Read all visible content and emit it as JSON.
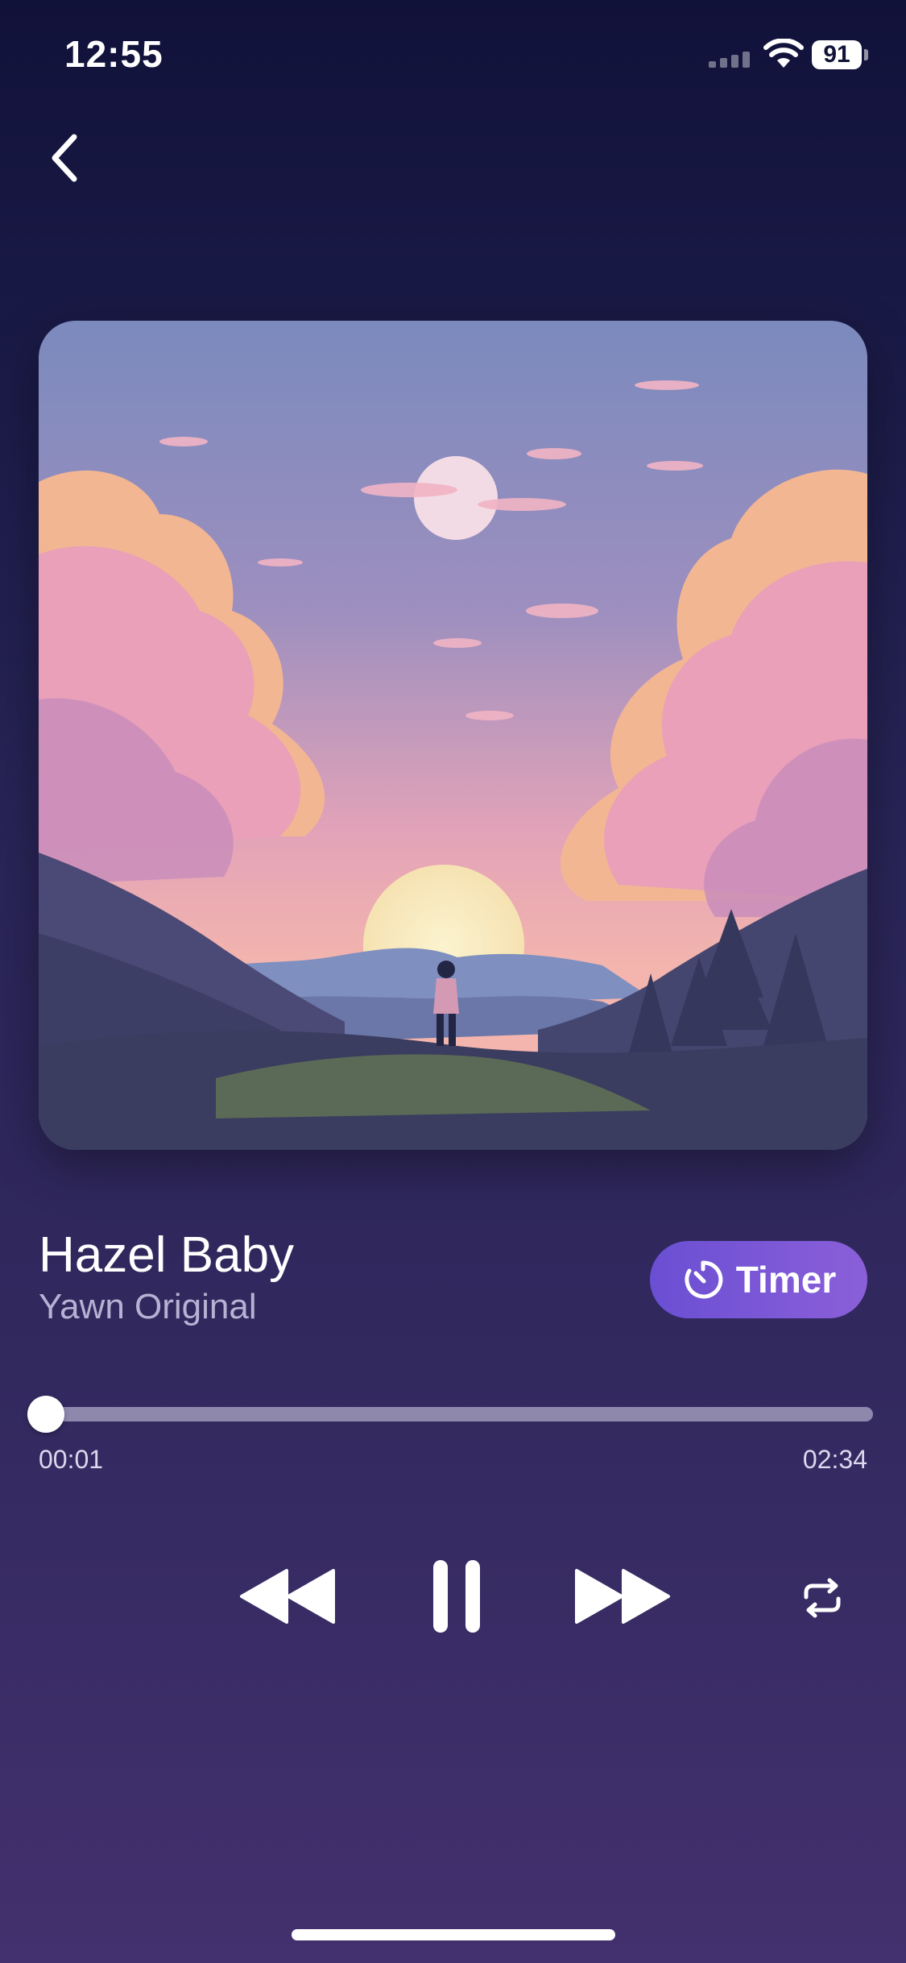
{
  "status_bar": {
    "time": "12:55",
    "battery": "91"
  },
  "nav": {
    "back_icon": "chevron-left-icon"
  },
  "track": {
    "title": "Hazel Baby",
    "artist": "Yawn Original",
    "artwork_icon": "sunset-landscape-artwork"
  },
  "timer_button": {
    "label": "Timer",
    "icon": "timer-icon",
    "color_start": "#6a4fd3",
    "color_end": "#8b5fd9"
  },
  "progress": {
    "current": "00:01",
    "duration": "02:34",
    "fraction": 0.0065
  },
  "controls": {
    "rewind_icon": "rewind-icon",
    "pause_icon": "pause-icon",
    "forward_icon": "fast-forward-icon",
    "repeat_icon": "repeat-icon"
  },
  "colors": {
    "background_top": "#11123a",
    "background_bottom": "#43306e",
    "subtitle": "#b7b2d3",
    "track": "#8f88ad"
  }
}
